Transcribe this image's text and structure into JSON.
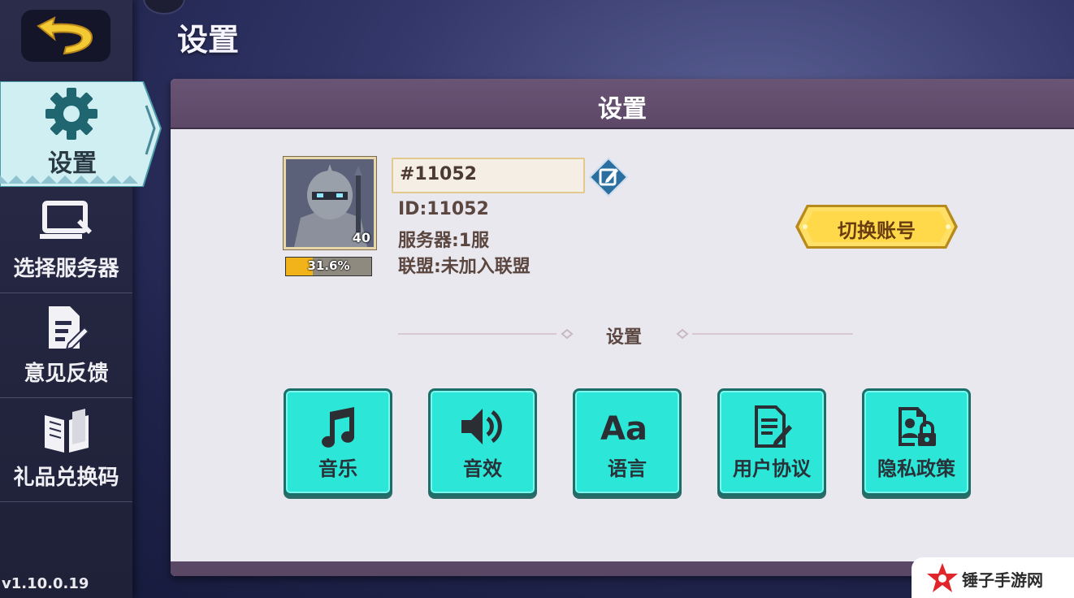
{
  "header": {
    "title": "设置"
  },
  "sidebar": {
    "items": [
      {
        "label": "设置",
        "icon": "gear-icon",
        "active": true
      },
      {
        "label": "选择服务器",
        "icon": "monitor-icon"
      },
      {
        "label": "意见反馈",
        "icon": "feedback-document-icon"
      },
      {
        "label": "礼品兑换码",
        "icon": "book-icon"
      }
    ],
    "version": "v1.10.0.19"
  },
  "panel": {
    "title": "设置",
    "profile": {
      "name": "#11052",
      "level": "40",
      "progress_text": "31.6%",
      "progress": 0.316,
      "id_line": "ID:11052",
      "server_line": "服务器:1服",
      "alliance_line": "联盟:未加入联盟"
    },
    "switch_account_label": "切换账号",
    "section_label": "设置",
    "tiles": [
      {
        "label": "音乐",
        "icon": "music-note-icon"
      },
      {
        "label": "音效",
        "icon": "speaker-icon"
      },
      {
        "label": "语言",
        "icon": "language-aa-icon"
      },
      {
        "label": "用户协议",
        "icon": "agreement-document-icon"
      },
      {
        "label": "隐私政策",
        "icon": "privacy-lock-icon"
      }
    ]
  },
  "watermark": {
    "text": "锤子手游网"
  },
  "colors": {
    "tile": "#2ce6d8",
    "panel_header": "#6a5475",
    "accent_gold": "#f2b21a"
  }
}
